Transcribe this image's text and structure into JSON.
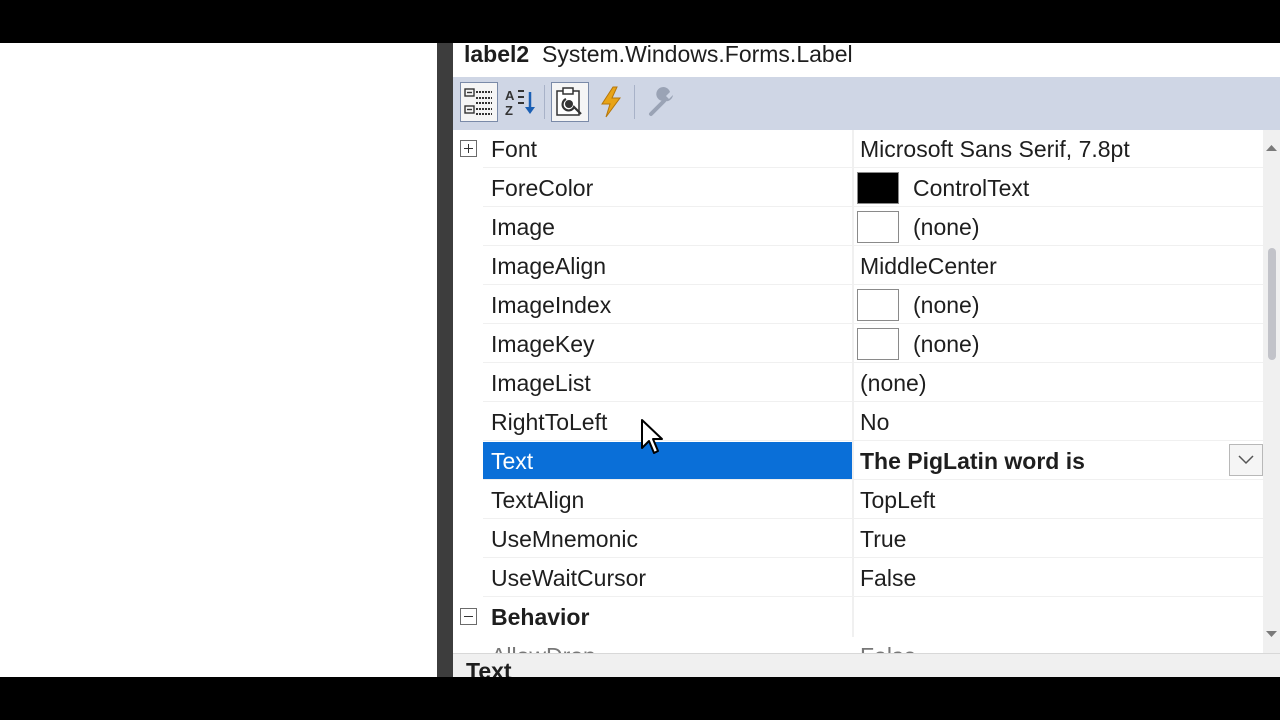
{
  "header": {
    "object_name": "label2",
    "object_type": "System.Windows.Forms.Label"
  },
  "toolbar": {
    "buttons": [
      {
        "name": "categorized-view-icon",
        "active": true
      },
      {
        "name": "alphabetical-sort-icon",
        "active": false
      },
      {
        "name": "properties-view-icon",
        "active": true
      },
      {
        "name": "events-lightning-icon",
        "active": false
      },
      {
        "name": "property-pages-wrench-icon",
        "active": false,
        "disabled": true
      }
    ]
  },
  "properties": [
    {
      "name": "Font",
      "value": "Microsoft Sans Serif, 7.8pt",
      "expandable": true
    },
    {
      "name": "ForeColor",
      "value": "ControlText",
      "swatch": "#000000"
    },
    {
      "name": "Image",
      "value": "(none)",
      "swatch": "#ffffff"
    },
    {
      "name": "ImageAlign",
      "value": "MiddleCenter"
    },
    {
      "name": "ImageIndex",
      "value": "(none)",
      "swatch": "#ffffff"
    },
    {
      "name": "ImageKey",
      "value": "(none)",
      "swatch": "#ffffff"
    },
    {
      "name": "ImageList",
      "value": "(none)"
    },
    {
      "name": "RightToLeft",
      "value": "No"
    },
    {
      "name": "Text",
      "value": "The PigLatin word is",
      "selected": true
    },
    {
      "name": "TextAlign",
      "value": "TopLeft"
    },
    {
      "name": "UseMnemonic",
      "value": "True"
    },
    {
      "name": "UseWaitCursor",
      "value": "False"
    }
  ],
  "category": {
    "behavior": "Behavior"
  },
  "partial": {
    "name": "AllowDrop",
    "value": "False"
  },
  "description": {
    "title": "Text"
  },
  "colors": {
    "selection": "#0a6fd8",
    "toolbar_bg": "#cfd6e5"
  }
}
